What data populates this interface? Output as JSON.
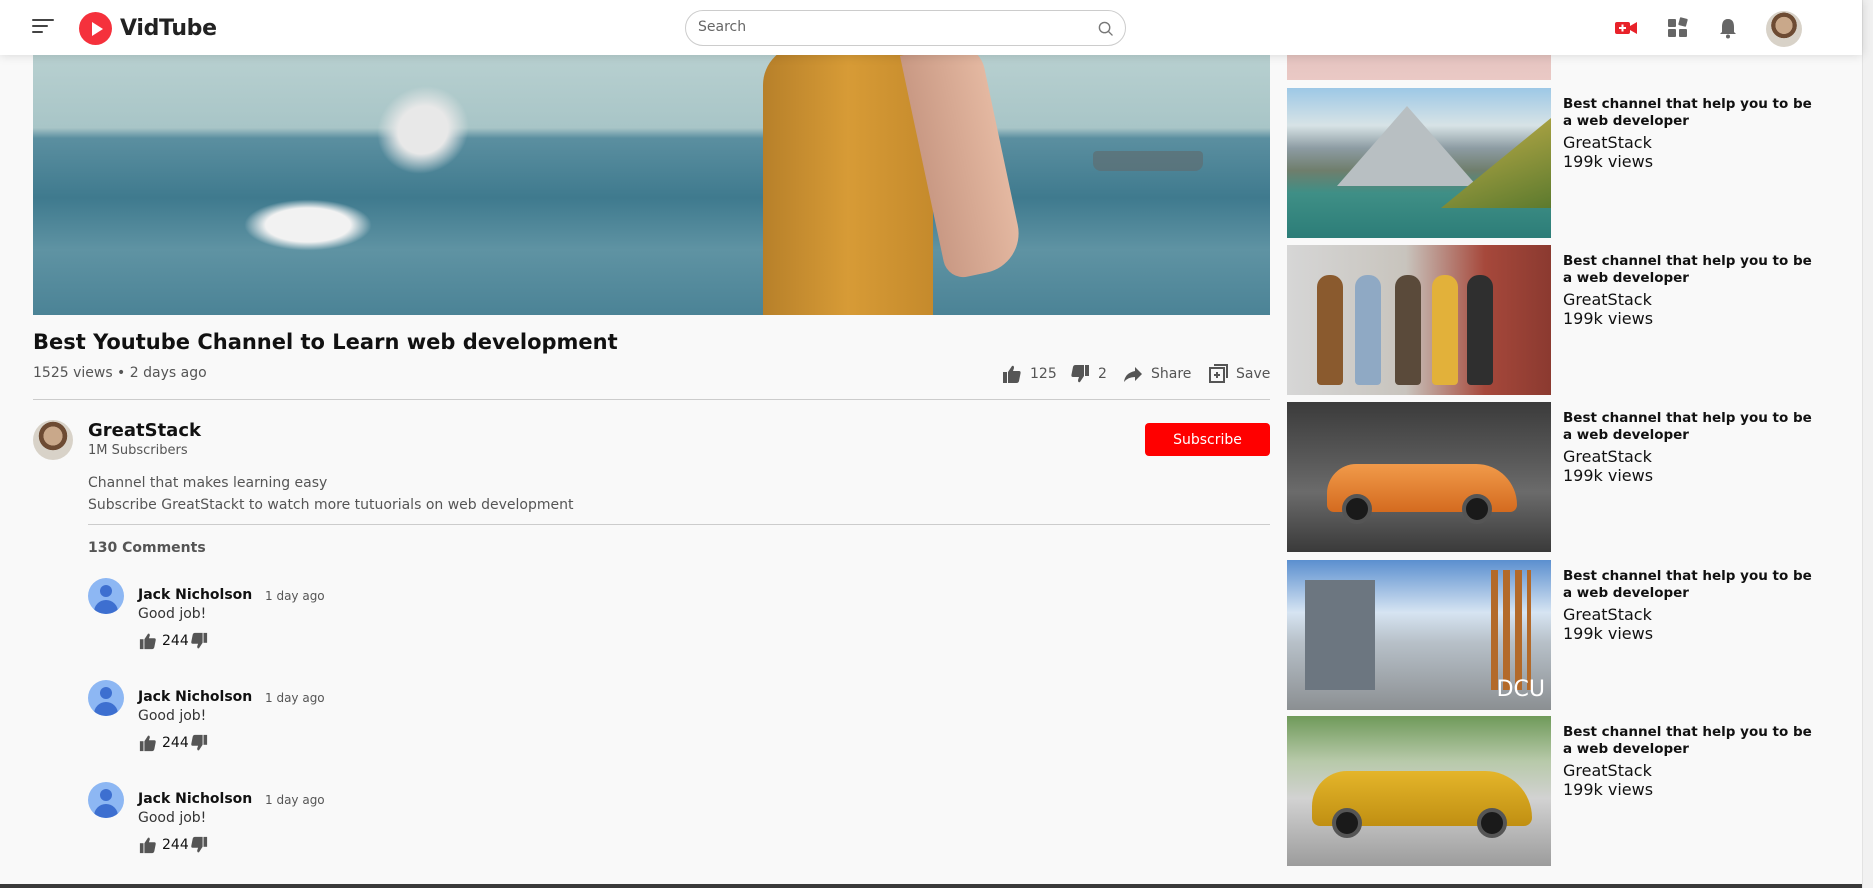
{
  "brand": {
    "name": "VidTube",
    "accent": "#f5313c"
  },
  "search": {
    "placeholder": "Search"
  },
  "video": {
    "title": "Best Youtube Channel to Learn web development",
    "meta": "1525 views • 2 days ago",
    "likes": "125",
    "dislikes": "2",
    "share_label": "Share",
    "save_label": "Save"
  },
  "channel": {
    "name": "GreatStack",
    "subscribers": "1M Subscribers",
    "subscribe_label": "Subscribe",
    "desc_line1": "Channel that makes learning easy",
    "desc_line2": "Subscribe GreatStackt to watch more tutuorials on web development"
  },
  "comments": {
    "count_label": "130 Comments",
    "items": [
      {
        "author": "Jack Nicholson",
        "time": "1 day ago",
        "text": "Good job!",
        "likes": "244"
      },
      {
        "author": "Jack Nicholson",
        "time": "1 day ago",
        "text": "Good job!",
        "likes": "244"
      },
      {
        "author": "Jack Nicholson",
        "time": "1 day ago",
        "text": "Good job!",
        "likes": "244"
      }
    ]
  },
  "sidebar": {
    "items": [
      {
        "title": "Best channel that help you to be a web developer",
        "channel": "GreatStack",
        "views": "199k views"
      },
      {
        "title": "Best channel that help you to be a web developer",
        "channel": "GreatStack",
        "views": "199k views"
      },
      {
        "title": "Best channel that help you to be a web developer",
        "channel": "GreatStack",
        "views": "199k views"
      },
      {
        "title": "Best channel that help you to be a web developer",
        "channel": "GreatStack",
        "views": "199k views"
      },
      {
        "title": "Best channel that help you to be a web developer",
        "channel": "GreatStack",
        "views": "199k views"
      }
    ]
  }
}
